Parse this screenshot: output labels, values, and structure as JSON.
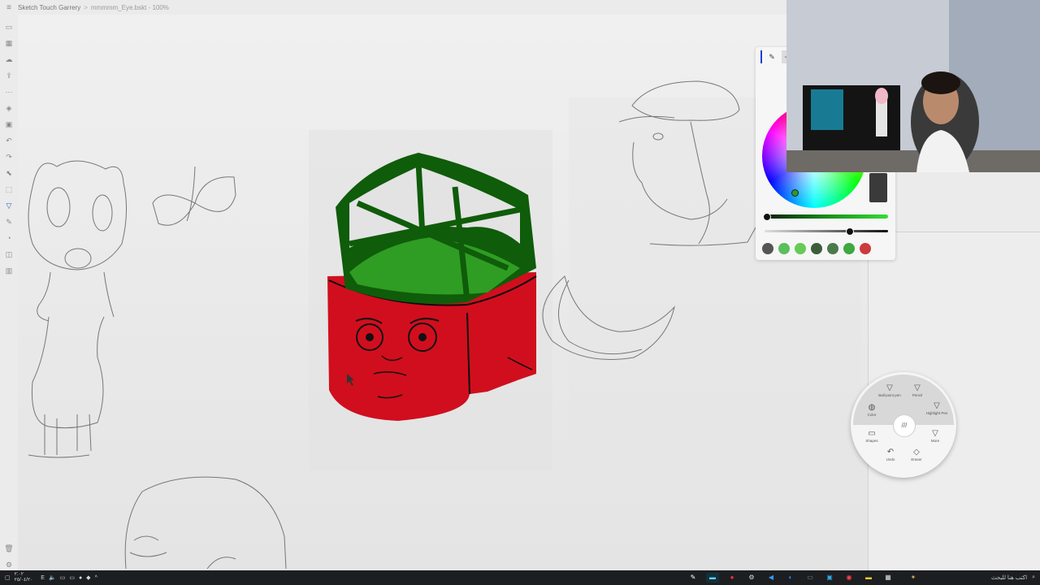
{
  "app": {
    "title": "Sketch Touch Garrery",
    "breadcrumb_sep": ">",
    "file_name": "mmmmm_Eye.bskt - 100%"
  },
  "toolbar": {
    "icons": [
      "menu-icon",
      "folder-icon",
      "grid-icon",
      "cloud-icon",
      "export-icon",
      "more-icon",
      "layers-icon",
      "insert-icon",
      "undo-icon",
      "redo-icon",
      "select-icon",
      "lasso-icon",
      "pen-icon",
      "marker-icon",
      "brush-icon",
      "stamp-icon",
      "settings-icon",
      "delete-icon"
    ]
  },
  "color_panel": {
    "pen_tab": "✎",
    "tab2": "⌁",
    "current_color": "#3a3a3a",
    "swatches": [
      "#555555",
      "#5bbf5b",
      "#64cc55",
      "#3b5d3b",
      "#4a7a4a",
      "#3fa83f",
      "#cc3b3b"
    ]
  },
  "radial_menu": {
    "items": [
      {
        "label": "Ball-point pen",
        "icon": "ballpoint-pen-icon",
        "glyph": "▽"
      },
      {
        "label": "Pencil",
        "icon": "pencil-icon",
        "glyph": "▽"
      },
      {
        "label": "Highlight Pen",
        "icon": "highlighter-icon",
        "glyph": "▽"
      },
      {
        "label": "Color",
        "icon": "color-icon",
        "glyph": "◍"
      },
      {
        "label": "More",
        "icon": "more-pens-icon",
        "glyph": "▽"
      },
      {
        "label": "Shapes",
        "icon": "shapes-icon",
        "glyph": "▭"
      },
      {
        "label": "Undo",
        "icon": "undo-icon",
        "glyph": "↶"
      },
      {
        "label": "Eraser",
        "icon": "eraser-icon",
        "glyph": "◇"
      }
    ],
    "hub_glyph": "///"
  },
  "taskbar": {
    "clock_line1": "٢:٠٢",
    "clock_line2": "٢٥/٠٤/٢٠",
    "lang": "E",
    "search_placeholder": "اكتب هنا للبحث"
  }
}
